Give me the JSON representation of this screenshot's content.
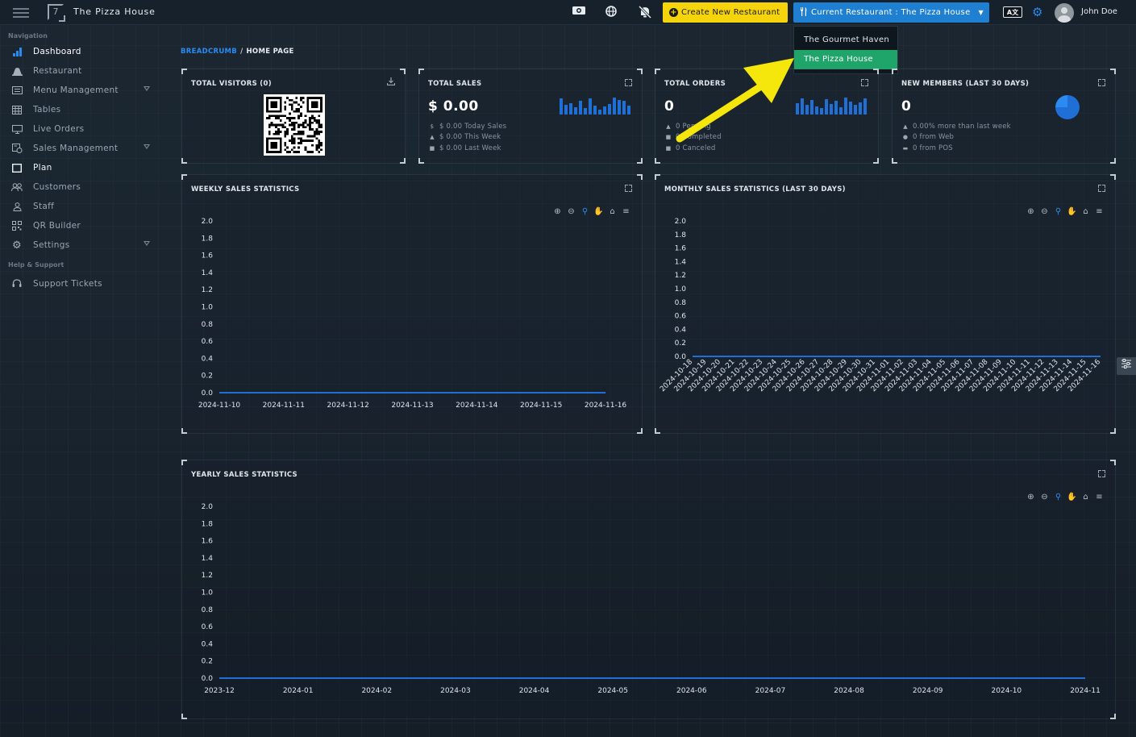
{
  "topbar": {
    "app_title": "The Pizza House",
    "create_button": "Create New Restaurant",
    "current_restaurant_button": "Current Restaurant : The Pizza House",
    "language_badge": "A文",
    "user_name": "John Doe",
    "icons": [
      "menu-icon",
      "logo-icon",
      "camera-icon",
      "globe-icon",
      "bell-off-icon",
      "settings-icon",
      "avatar"
    ]
  },
  "dropdown": {
    "items": [
      "The Gourmet Haven",
      "The Pizza House"
    ],
    "active_index": 1
  },
  "sidebar": {
    "section_navigation": "Navigation",
    "section_help": "Help & Support",
    "items": [
      {
        "label": "Dashboard",
        "icon": "bar-chart-icon",
        "active": true
      },
      {
        "label": "Restaurant",
        "icon": "utensils-icon"
      },
      {
        "label": "Menu Management",
        "icon": "list-icon",
        "expandable": true
      },
      {
        "label": "Tables",
        "icon": "table-icon"
      },
      {
        "label": "Live Orders",
        "icon": "monitor-icon"
      },
      {
        "label": "Sales Management",
        "icon": "sales-icon",
        "expandable": true
      },
      {
        "label": "Plan",
        "icon": "square-icon"
      },
      {
        "label": "Customers",
        "icon": "customers-icon"
      },
      {
        "label": "Staff",
        "icon": "user-icon"
      },
      {
        "label": "QR Builder",
        "icon": "qr-icon"
      },
      {
        "label": "Settings",
        "icon": "gear-icon",
        "expandable": true
      }
    ],
    "help_items": [
      {
        "label": "Support Tickets",
        "icon": "headset-icon"
      }
    ]
  },
  "breadcrumb": {
    "link": "BREADCRUMB",
    "separator": "/",
    "current": "HOME PAGE"
  },
  "stats": {
    "visitors": {
      "title": "TOTAL VISITORS (0)"
    },
    "sales": {
      "title": "TOTAL SALES",
      "value": "$ 0.00",
      "rows": [
        "$ 0.00 Today Sales",
        "$ 0.00 This Week",
        "$ 0.00 Last Week"
      ]
    },
    "orders": {
      "title": "TOTAL ORDERS",
      "value": "0",
      "rows": [
        "0 Pending",
        "0 Completed",
        "0 Canceled"
      ]
    },
    "members": {
      "title": "NEW MEMBERS (LAST 30 DAYS)",
      "value": "0",
      "rows": [
        "0.00% more than last week",
        "0 from Web",
        "0 from POS"
      ]
    }
  },
  "colors": {
    "accent": "#2b8bf0",
    "create_button": "#f5d40c",
    "current_button": "#1f7fd0",
    "active_dropdown": "#1fa46a",
    "chart_line": "#1f6fd6"
  },
  "chart_data": [
    {
      "type": "line",
      "title": "WEEKLY SALES STATISTICS",
      "categories": [
        "2024-11-10",
        "2024-11-11",
        "2024-11-12",
        "2024-11-13",
        "2024-11-14",
        "2024-11-15",
        "2024-11-16"
      ],
      "series": [
        {
          "values": [
            0,
            0,
            0,
            0,
            0,
            0,
            0
          ]
        }
      ],
      "yticks": [
        "2.0",
        "1.8",
        "1.6",
        "1.4",
        "1.2",
        "1.0",
        "0.8",
        "0.6",
        "0.4",
        "0.2",
        "0.0"
      ],
      "ylim": [
        0,
        2
      ],
      "grid": false
    },
    {
      "type": "line",
      "title": "MONTHLY SALES STATISTICS (LAST 30 DAYS)",
      "categories": [
        "2024-10-18",
        "2024-10-19",
        "2024-10-20",
        "2024-10-21",
        "2024-10-22",
        "2024-10-23",
        "2024-10-24",
        "2024-10-25",
        "2024-10-26",
        "2024-10-27",
        "2024-10-28",
        "2024-10-29",
        "2024-10-30",
        "2024-10-31",
        "2024-11-01",
        "2024-11-02",
        "2024-11-03",
        "2024-11-04",
        "2024-11-05",
        "2024-11-06",
        "2024-11-07",
        "2024-11-08",
        "2024-11-09",
        "2024-11-10",
        "2024-11-11",
        "2024-11-12",
        "2024-11-13",
        "2024-11-14",
        "2024-11-15",
        "2024-11-16"
      ],
      "series": [
        {
          "values": [
            0,
            0,
            0,
            0,
            0,
            0,
            0,
            0,
            0,
            0,
            0,
            0,
            0,
            0,
            0,
            0,
            0,
            0,
            0,
            0,
            0,
            0,
            0,
            0,
            0,
            0,
            0,
            0,
            0,
            0
          ]
        }
      ],
      "yticks": [
        "2.0",
        "1.8",
        "1.6",
        "1.4",
        "1.2",
        "1.0",
        "0.8",
        "0.6",
        "0.4",
        "0.2",
        "0.0"
      ],
      "ylim": [
        0,
        2
      ],
      "grid": false
    },
    {
      "type": "line",
      "title": "YEARLY SALES STATISTICS",
      "categories": [
        "2023-12",
        "2024-01",
        "2024-02",
        "2024-03",
        "2024-04",
        "2024-05",
        "2024-06",
        "2024-07",
        "2024-08",
        "2024-09",
        "2024-10",
        "2024-11"
      ],
      "series": [
        {
          "values": [
            0,
            0,
            0,
            0,
            0,
            0,
            0,
            0,
            0,
            0,
            0,
            0
          ]
        }
      ],
      "yticks": [
        "2.0",
        "1.8",
        "1.6",
        "1.4",
        "1.2",
        "1.0",
        "0.8",
        "0.6",
        "0.4",
        "0.2",
        "0.0"
      ],
      "ylim": [
        0,
        2
      ],
      "grid": false
    }
  ]
}
